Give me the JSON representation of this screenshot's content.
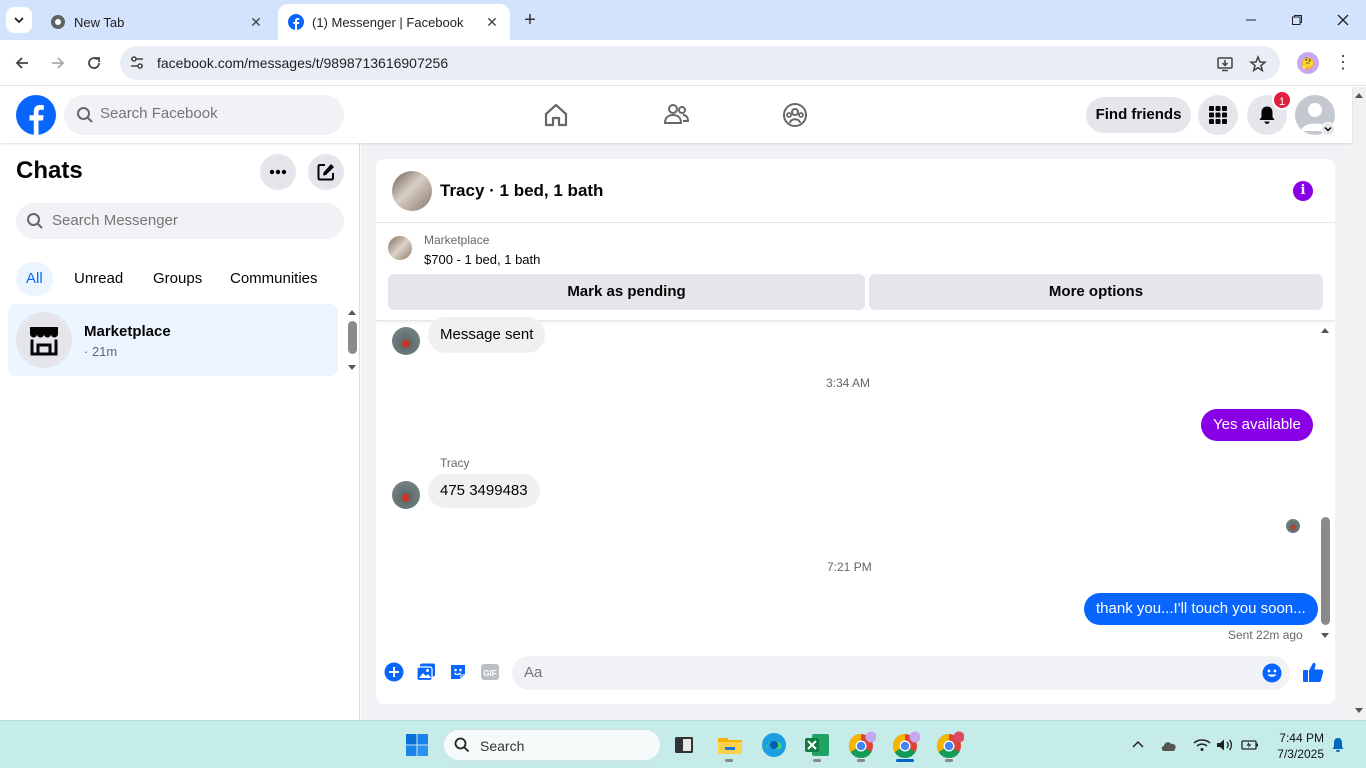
{
  "browser": {
    "tabs": [
      {
        "title": "New Tab",
        "active": false
      },
      {
        "title": "(1) Messenger | Facebook",
        "active": true
      }
    ],
    "url": "facebook.com/messages/t/9898713616907256"
  },
  "facebook": {
    "search_placeholder": "Search Facebook",
    "find_friends_label": "Find friends",
    "notification_count": "1"
  },
  "left_panel": {
    "title": "Chats",
    "search_placeholder": "Search Messenger",
    "filters": [
      "All",
      "Unread",
      "Groups",
      "Communities"
    ],
    "active_filter": "All",
    "chats": [
      {
        "name": "Marketplace",
        "time": "· 21m"
      }
    ]
  },
  "conversation": {
    "title": "Tracy · 1 bed, 1 bath",
    "marketplace": {
      "label": "Marketplace",
      "item": "$700 - 1 bed, 1 bath",
      "pending_button": "Mark as pending",
      "options_button": "More options"
    },
    "messages": {
      "m1": "Message sent",
      "ts1": "3:34 AM",
      "m2": "Yes available",
      "sender": "Tracy",
      "m3": "475 3499483",
      "ts2": "7:21 PM",
      "m4": "thank you...I'll touch you soon...",
      "status": "Sent 22m ago"
    },
    "composer_placeholder": "Aa",
    "colors": {
      "purple_bubble": "#8a00e6",
      "blue_bubble": "#0866ff",
      "info_accent": "#8a00e6"
    }
  },
  "taskbar": {
    "search_label": "Search",
    "time": "7:44 PM",
    "date": "7/3/2025"
  }
}
